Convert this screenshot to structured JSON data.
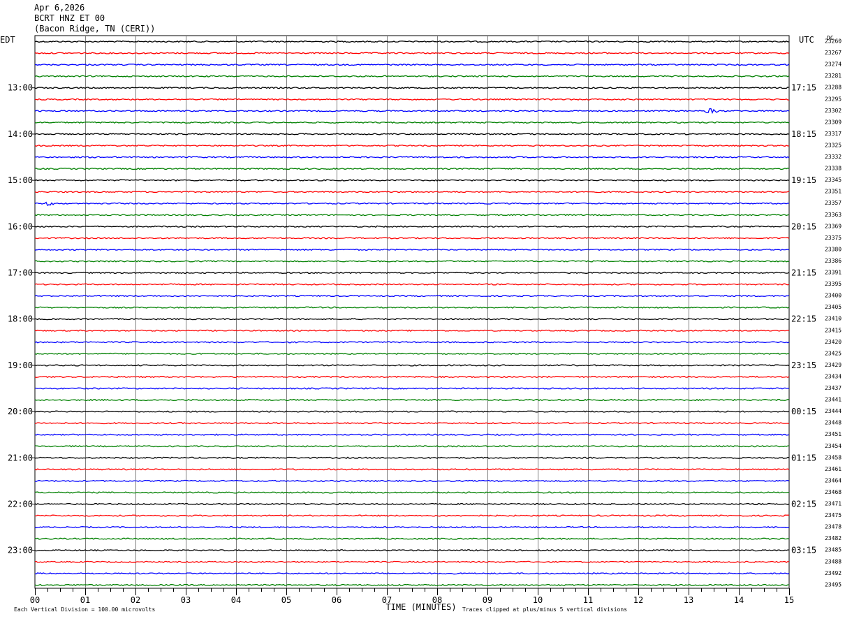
{
  "header": {
    "date": "Apr 6,2026",
    "station": "BCRT HNZ ET 00",
    "location": "(Bacon Ridge, TN (CERI))"
  },
  "chart_data": {
    "type": "line",
    "left_timezone": "EDT",
    "right_timezone": "UTC",
    "dc_label": "DC",
    "xlabel": "TIME (MINUTES)",
    "x_ticks": [
      "00",
      "01",
      "02",
      "03",
      "04",
      "05",
      "06",
      "07",
      "08",
      "09",
      "10",
      "11",
      "12",
      "13",
      "14",
      "15"
    ],
    "xlim": [
      0,
      15
    ],
    "left_hour_labels": [
      "13:00",
      "14:00",
      "15:00",
      "16:00",
      "17:00",
      "18:00",
      "19:00",
      "20:00",
      "21:00",
      "22:00",
      "23:00"
    ],
    "right_hour_labels": [
      "17:15",
      "18:15",
      "19:15",
      "20:15",
      "21:15",
      "22:15",
      "23:15",
      "00:15",
      "01:15",
      "02:15",
      "03:15"
    ],
    "dc_offsets": [
      23260,
      23267,
      23274,
      23281,
      23288,
      23295,
      23302,
      23309,
      23317,
      23325,
      23332,
      23338,
      23345,
      23351,
      23357,
      23363,
      23369,
      23375,
      23380,
      23386,
      23391,
      23395,
      23400,
      23405,
      23410,
      23415,
      23420,
      23425,
      23429,
      23434,
      23437,
      23441,
      23444,
      23448,
      23451,
      23454,
      23458,
      23461,
      23464,
      23468,
      23471,
      23475,
      23478,
      23482,
      23485,
      23488,
      23492,
      23495
    ],
    "trace_colors": [
      "#000000",
      "#ff0000",
      "#0000ff",
      "#008000"
    ],
    "events": [
      {
        "trace": 6,
        "minute": 13.45,
        "amplitude": 4
      },
      {
        "trace": 14,
        "minute": 0.25,
        "amplitude": 3
      }
    ],
    "footer_left": "Each Vertical Division =  100.00 microvolts",
    "footer_right": "Traces clipped at plus/minus 5 vertical divisions"
  }
}
